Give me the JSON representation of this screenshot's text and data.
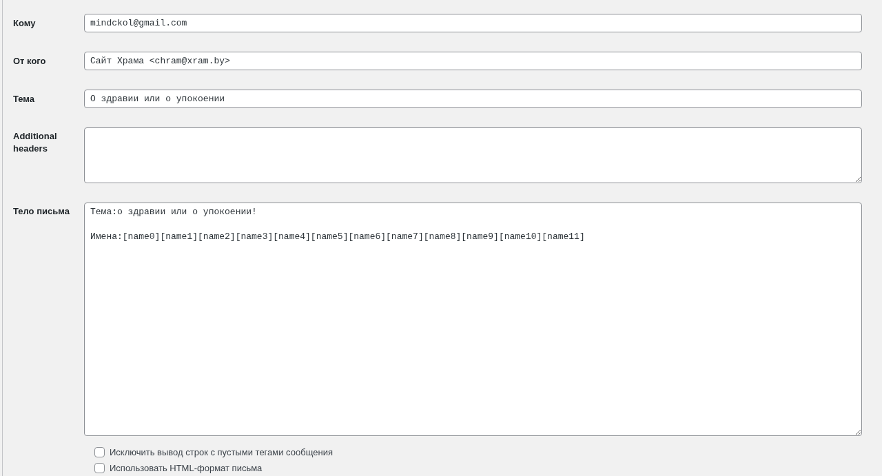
{
  "fields": [
    {
      "kind": "input",
      "label": "Кому",
      "value": "mindckol@gmail.com"
    },
    {
      "kind": "input",
      "label": "От кого",
      "value": "Сайт Храма <chram@xram.by>"
    },
    {
      "kind": "input",
      "label": "Тема",
      "value": "О здравии или о упокоении"
    },
    {
      "kind": "textarea",
      "label": "Additional headers"
    },
    {
      "kind": "body",
      "label": "Тело письма",
      "value": "Тема:о здравии или о упокоении!\n\nИмена:[name0][name1][name2][name3][name4][name5][name6][name7][name8][name9][name10][name11]"
    }
  ],
  "options": [
    {
      "label": "Исключить вывод строк с пустыми тегами сообщения",
      "checked": false
    },
    {
      "label": "Использовать HTML-формат письма",
      "checked": false
    }
  ]
}
